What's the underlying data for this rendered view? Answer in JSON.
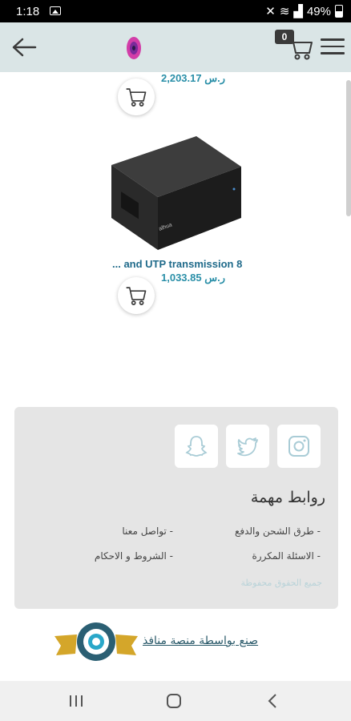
{
  "status_bar": {
    "time": "1:18",
    "battery": "49%"
  },
  "header": {
    "cart_count": "0"
  },
  "products": [
    {
      "price": "2,203.17 ر.س"
    },
    {
      "title": "... and UTP transmission 8",
      "price": "1,033.85 ر.س"
    }
  ],
  "footer": {
    "links_heading": "روابط مهمة",
    "links": [
      "- طرق الشحن والدفع",
      "- تواصل معنا",
      "- الاسئلة المكررة",
      "- الشروط و الاحكام"
    ],
    "copyright": "جميع الحقوق محفوظة"
  },
  "made_by": "صنع بواسطة منصة منافذ",
  "colors": {
    "header_bg": "#dae5e6",
    "price": "#2a8fa8",
    "footer_bg": "#e5e5e5"
  }
}
